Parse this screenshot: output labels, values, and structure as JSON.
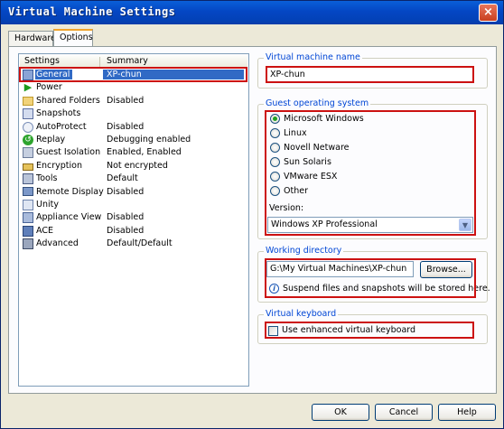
{
  "window": {
    "title": "Virtual Machine Settings",
    "close": "×"
  },
  "tabs": [
    {
      "label": "Hardware",
      "active": false
    },
    {
      "label": "Options",
      "active": true
    }
  ],
  "list": {
    "headers": {
      "settings": "Settings",
      "summary": "Summary"
    },
    "rows": [
      {
        "label": "General",
        "summary": "XP-chun",
        "icon": "general-icon",
        "selected": true
      },
      {
        "label": "Power",
        "summary": "",
        "icon": "power-icon"
      },
      {
        "label": "Shared Folders",
        "summary": "Disabled",
        "icon": "folder-icon"
      },
      {
        "label": "Snapshots",
        "summary": "",
        "icon": "snapshot-icon"
      },
      {
        "label": "AutoProtect",
        "summary": "Disabled",
        "icon": "autoprotect-icon"
      },
      {
        "label": "Replay",
        "summary": "Debugging enabled",
        "icon": "replay-icon"
      },
      {
        "label": "Guest Isolation",
        "summary": "Enabled, Enabled",
        "icon": "isolation-icon"
      },
      {
        "label": "Encryption",
        "summary": "Not encrypted",
        "icon": "lock-icon"
      },
      {
        "label": "Tools",
        "summary": "Default",
        "icon": "tools-icon"
      },
      {
        "label": "Remote Display",
        "summary": "Disabled",
        "icon": "display-icon"
      },
      {
        "label": "Unity",
        "summary": "",
        "icon": "unity-icon"
      },
      {
        "label": "Appliance View",
        "summary": "Disabled",
        "icon": "appliance-icon"
      },
      {
        "label": "ACE",
        "summary": "Disabled",
        "icon": "ace-icon"
      },
      {
        "label": "Advanced",
        "summary": "Default/Default",
        "icon": "advanced-icon"
      }
    ]
  },
  "vm_name": {
    "title": "Virtual machine name",
    "value": "XP-chun"
  },
  "guest_os": {
    "title": "Guest operating system",
    "options": [
      "Microsoft Windows",
      "Linux",
      "Novell Netware",
      "Sun Solaris",
      "VMware ESX",
      "Other"
    ],
    "selected": "Microsoft Windows",
    "version_label": "Version:",
    "version_value": "Windows XP Professional"
  },
  "working_dir": {
    "title": "Working directory",
    "path": "G:\\My Virtual Machines\\XP-chun",
    "browse": "Browse...",
    "info": "Suspend files and snapshots will be stored here."
  },
  "keyboard": {
    "title": "Virtual keyboard",
    "checkbox_label": "Use enhanced virtual keyboard",
    "checked": false
  },
  "buttons": {
    "ok": "OK",
    "cancel": "Cancel",
    "help": "Help"
  },
  "colors": {
    "highlight": "#cc1111",
    "selection": "#316ac5",
    "group_title": "#0046d5"
  }
}
